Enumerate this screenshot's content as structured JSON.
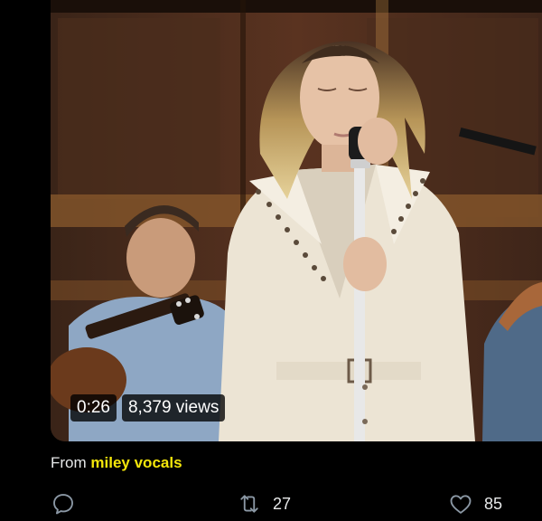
{
  "video": {
    "duration": "0:26",
    "views": "8,379 views"
  },
  "source": {
    "prefix": "From",
    "link": "miley vocals"
  },
  "actions": {
    "reply": {
      "icon": "reply-icon"
    },
    "retweet": {
      "icon": "retweet-icon",
      "count": "27"
    },
    "like": {
      "icon": "heart-icon",
      "count": "85"
    }
  },
  "colors": {
    "background": "#000000",
    "text": "#e7e9ea",
    "source_link": "#f4e60b",
    "icon": "#8b98a5"
  }
}
